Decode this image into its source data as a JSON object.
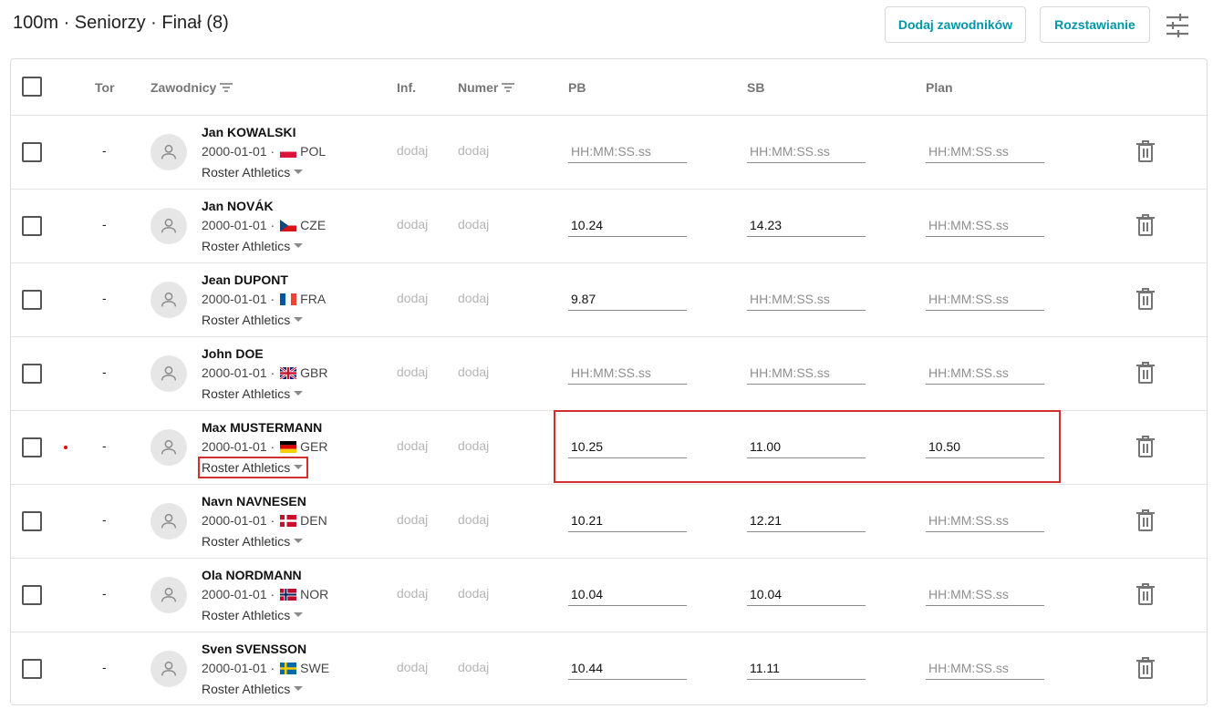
{
  "page": {
    "title": "100m · Seniorzy · Finał (8)"
  },
  "toolbar": {
    "add_label": "Dodaj zawodników",
    "seed_label": "Rozstawianie",
    "settings_icon": "tune-icon"
  },
  "table": {
    "headers": {
      "lane": "Tor",
      "athletes": "Zawodnicy",
      "info": "Inf.",
      "number": "Numer",
      "pb": "PB",
      "sb": "SB",
      "plan": "Plan"
    },
    "placeholder": "HH:MM:SS.ss",
    "add_text": "dodaj",
    "rows": [
      {
        "lane": "-",
        "name": "Jan KOWALSKI",
        "dob": "2000-01-01 ·",
        "country": "POL",
        "club": "Roster Athletics",
        "info": "dodaj",
        "number": "dodaj",
        "pb": "",
        "sb": "",
        "plan": ""
      },
      {
        "lane": "-",
        "name": "Jan NOVÁK",
        "dob": "2000-01-01 ·",
        "country": "CZE",
        "club": "Roster Athletics",
        "info": "dodaj",
        "number": "dodaj",
        "pb": "10.24",
        "sb": "14.23",
        "plan": ""
      },
      {
        "lane": "-",
        "name": "Jean DUPONT",
        "dob": "2000-01-01 ·",
        "country": "FRA",
        "club": "Roster Athletics",
        "info": "dodaj",
        "number": "dodaj",
        "pb": "9.87",
        "sb": "",
        "plan": ""
      },
      {
        "lane": "-",
        "name": "John DOE",
        "dob": "2000-01-01 ·",
        "country": "GBR",
        "club": "Roster Athletics",
        "info": "dodaj",
        "number": "dodaj",
        "pb": "",
        "sb": "",
        "plan": ""
      },
      {
        "lane": "-",
        "name": "Max MUSTERMANN",
        "dob": "2000-01-01 ·",
        "country": "GER",
        "club": "Roster Athletics",
        "info": "dodaj",
        "number": "dodaj",
        "pb": "10.25",
        "sb": "11.00",
        "plan": "10.50"
      },
      {
        "lane": "-",
        "name": "Navn NAVNESEN",
        "dob": "2000-01-01 ·",
        "country": "DEN",
        "club": "Roster Athletics",
        "info": "dodaj",
        "number": "dodaj",
        "pb": "10.21",
        "sb": "12.21",
        "plan": ""
      },
      {
        "lane": "-",
        "name": "Ola NORDMANN",
        "dob": "2000-01-01 ·",
        "country": "NOR",
        "club": "Roster Athletics",
        "info": "dodaj",
        "number": "dodaj",
        "pb": "10.04",
        "sb": "10.04",
        "plan": ""
      },
      {
        "lane": "-",
        "name": "Sven SVENSSON",
        "dob": "2000-01-01 ·",
        "country": "SWE",
        "club": "Roster Athletics",
        "info": "dodaj",
        "number": "dodaj",
        "pb": "10.44",
        "sb": "11.11",
        "plan": ""
      }
    ]
  },
  "colors": {
    "accent": "#0097a7",
    "highlight": "#d32f2f"
  }
}
